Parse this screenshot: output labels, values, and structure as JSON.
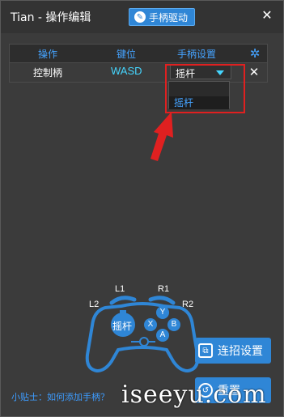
{
  "window": {
    "title": "Tian - 操作编辑",
    "driver_button": "手柄驱动",
    "close_glyph": "✕"
  },
  "table": {
    "headers": [
      "操作",
      "键位",
      "手柄设置"
    ],
    "rows": [
      {
        "name": "控制柄",
        "key": "WASD",
        "setting": "摇杆"
      }
    ]
  },
  "dropdown": {
    "options": [
      "摇杆"
    ]
  },
  "gamepad": {
    "shoulders": {
      "l1": "L1",
      "r1": "R1",
      "l2": "L2",
      "r2": "R2"
    },
    "stick_label": "摇杆",
    "buttons": {
      "y": "Y",
      "x": "X",
      "b": "B",
      "a": "A"
    }
  },
  "side_buttons": {
    "combo": "连招设置",
    "reset": "重置"
  },
  "tip": "小贴士：如何添加手柄？",
  "watermark": "iseeyu.com",
  "colors": {
    "accent": "#2f86d6",
    "link": "#45a3ff",
    "key_text": "#45d6ff",
    "highlight": "#e02020",
    "background": "#3b3b3b"
  },
  "icons": [
    "wrench-icon",
    "close-icon",
    "gear-icon",
    "caret-down-icon",
    "delete-icon",
    "combo-icon",
    "reset-icon"
  ]
}
